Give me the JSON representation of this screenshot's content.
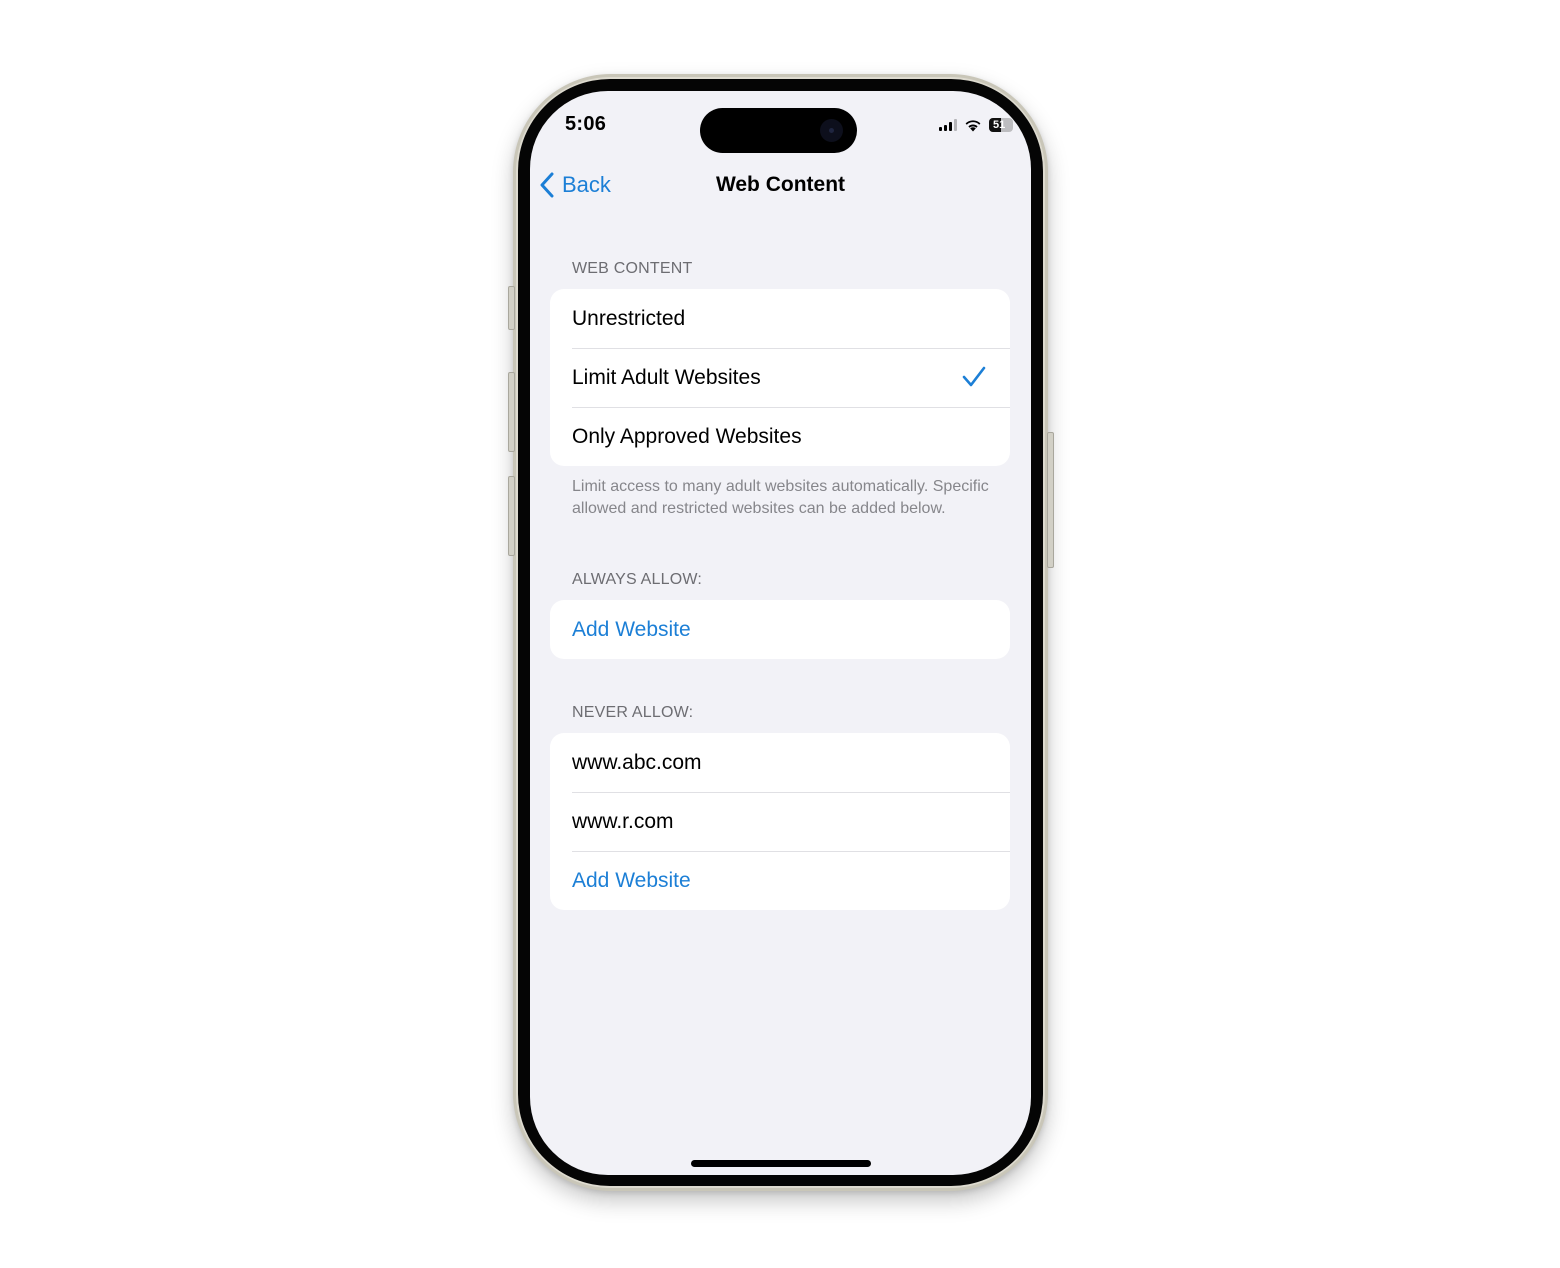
{
  "status_bar": {
    "time": "5:06",
    "signal_bars_active": 3,
    "signal_bars_total": 4,
    "wifi": "wifi-icon",
    "battery_level": "51",
    "battery_percent": 51
  },
  "nav": {
    "back_label": "Back",
    "title": "Web Content"
  },
  "web_content_section": {
    "header": "WEB CONTENT",
    "options": [
      {
        "label": "Unrestricted",
        "selected": false
      },
      {
        "label": "Limit Adult Websites",
        "selected": true
      },
      {
        "label": "Only Approved Websites",
        "selected": false
      }
    ],
    "footer": "Limit access to many adult websites automatically. Specific allowed and restricted websites can be added below."
  },
  "always_allow_section": {
    "header": "ALWAYS ALLOW:",
    "add_label": "Add Website"
  },
  "never_allow_section": {
    "header": "NEVER ALLOW:",
    "sites": [
      "www.abc.com",
      "www.r.com"
    ],
    "add_label": "Add Website"
  },
  "colors": {
    "accent": "#1c7fd6",
    "background": "#f2f2f7",
    "secondary_text": "#6d6d72"
  }
}
